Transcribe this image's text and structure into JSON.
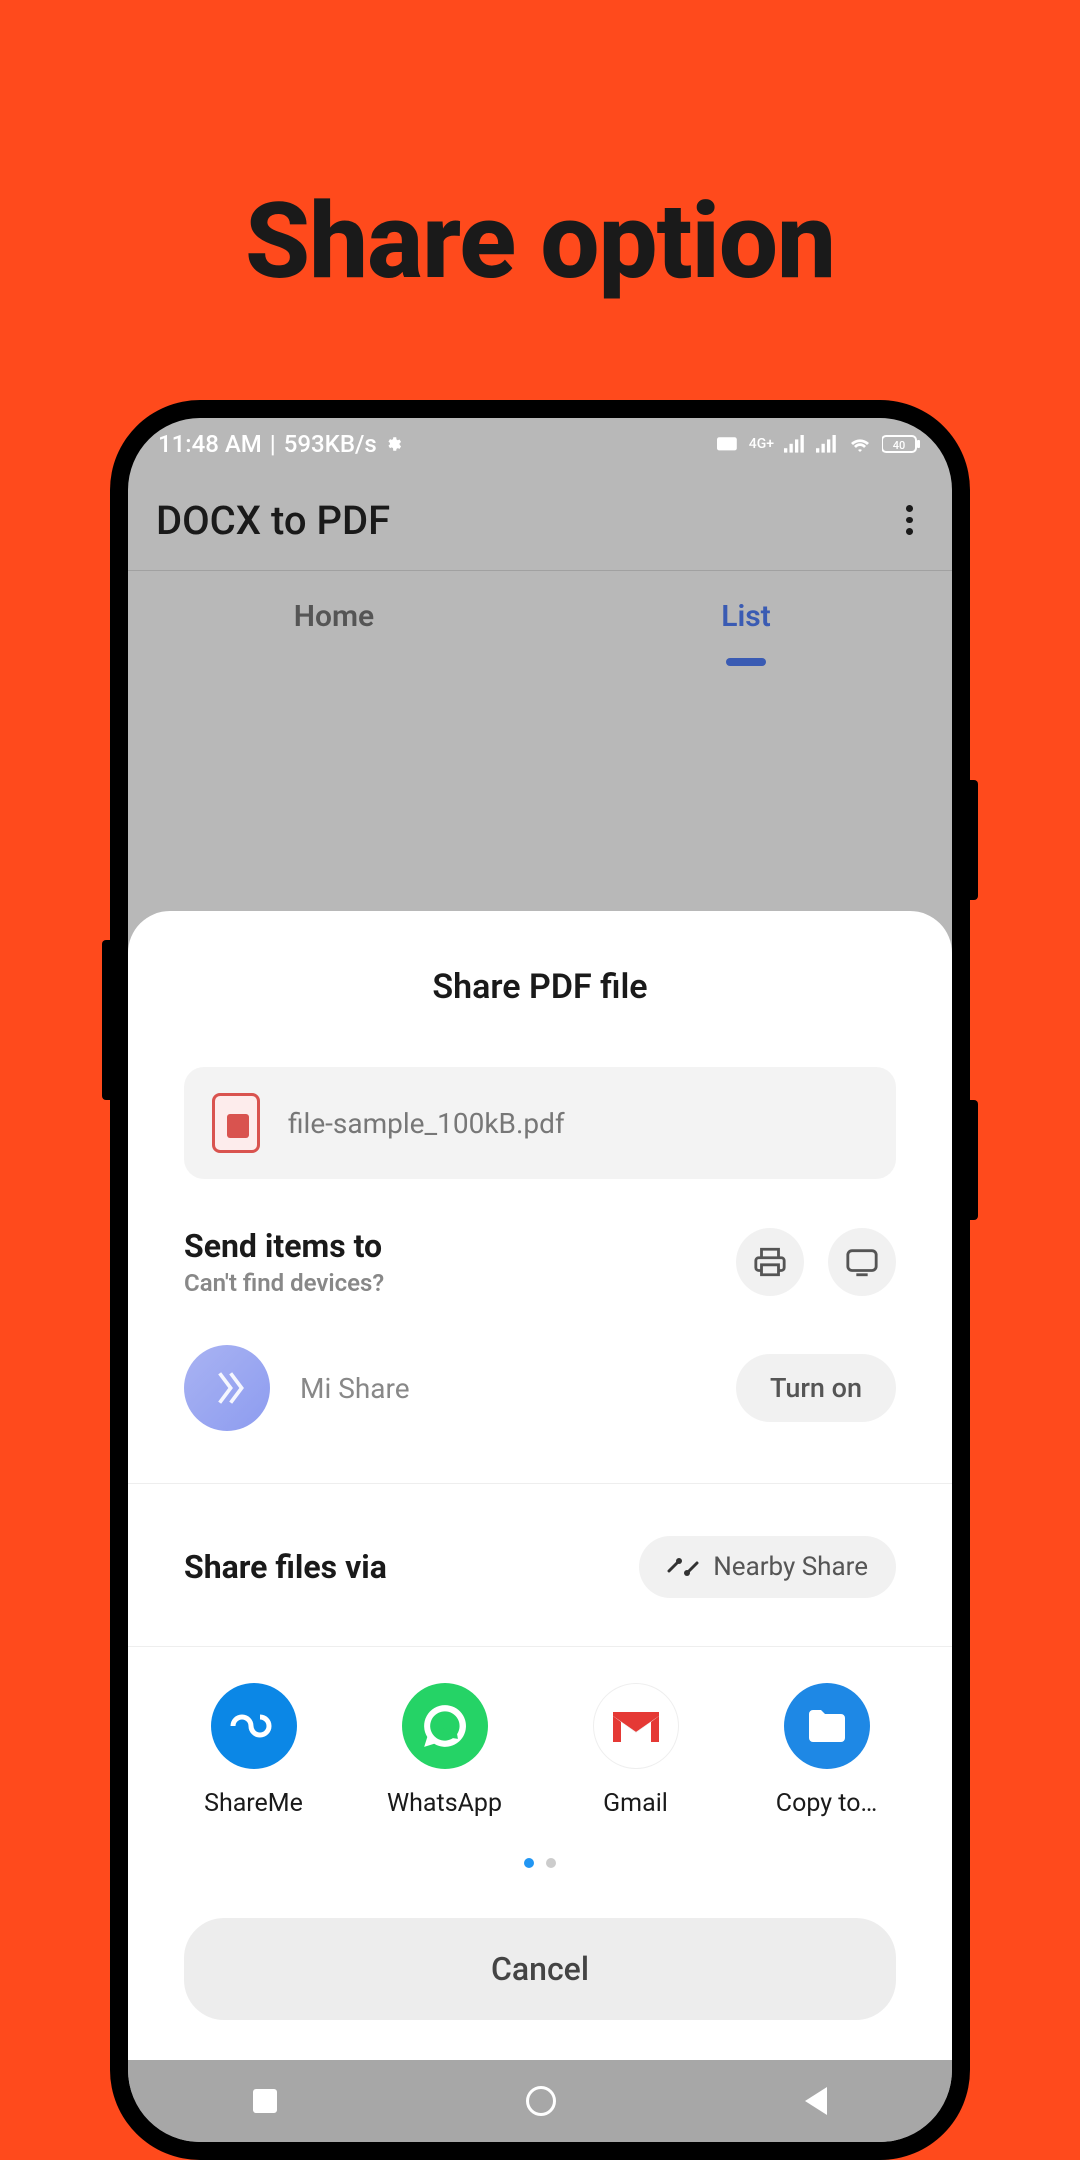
{
  "headline": "Share option",
  "statusbar": {
    "time": "11:48 AM",
    "speed": "593KB/s",
    "battery": "40"
  },
  "app": {
    "title": "DOCX to PDF"
  },
  "tabs": {
    "home": "Home",
    "list": "List"
  },
  "sheet": {
    "title": "Share PDF file",
    "filename": "file-sample_100kB.pdf",
    "send_title": "Send items to",
    "send_sub": "Can't find devices?",
    "mishare_label": "Mi Share",
    "turn_on": "Turn on",
    "sharevia_title": "Share files via",
    "nearby": "Nearby Share",
    "apps": [
      {
        "label": "ShareMe"
      },
      {
        "label": "WhatsApp"
      },
      {
        "label": "Gmail"
      },
      {
        "label": "Copy to…"
      }
    ],
    "cancel": "Cancel"
  }
}
